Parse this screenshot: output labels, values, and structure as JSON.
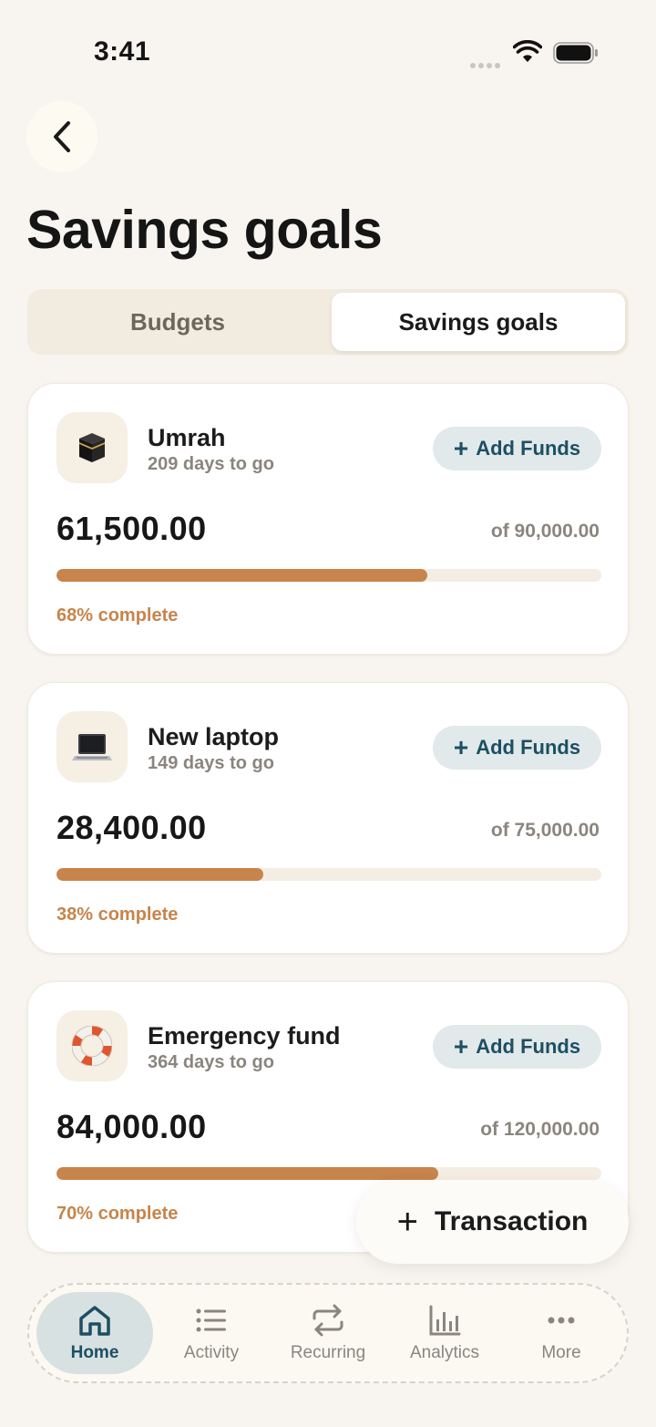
{
  "status_bar": {
    "time": "3:41"
  },
  "header": {
    "title": "Savings goals"
  },
  "segmented": {
    "tabs": [
      {
        "label": "Budgets"
      },
      {
        "label": "Savings goals"
      }
    ],
    "active": "Savings goals"
  },
  "goals": [
    {
      "name": "Umrah",
      "days": "209 days to go",
      "amount": "61,500.00",
      "target": "of 90,000.00",
      "progress": 0.68,
      "complete": "68% complete",
      "icon": "kaaba-icon",
      "button": "Add Funds"
    },
    {
      "name": "New laptop",
      "days": "149 days to go",
      "amount": "28,400.00",
      "target": "of 75,000.00",
      "progress": 0.38,
      "complete": "38% complete",
      "icon": "laptop-icon",
      "button": "Add Funds"
    },
    {
      "name": "Emergency fund",
      "days": "364 days to go",
      "amount": "84,000.00",
      "target": "of 120,000.00",
      "progress": 0.7,
      "complete": "70% complete",
      "icon": "life-ring-icon",
      "button": "Add Funds"
    }
  ],
  "fab": {
    "label": "Transaction"
  },
  "tab_bar": {
    "items": [
      {
        "label": "Home",
        "icon": "home-icon",
        "active": true
      },
      {
        "label": "Activity",
        "icon": "list-icon",
        "active": false
      },
      {
        "label": "Recurring",
        "icon": "repeat-icon",
        "active": false
      },
      {
        "label": "Analytics",
        "icon": "bar-chart-icon",
        "active": false
      },
      {
        "label": "More",
        "icon": "more-icon",
        "active": false
      }
    ]
  },
  "colors": {
    "background": "#f8f4ef",
    "accent": "#c7844b",
    "primary": "#1d4f63",
    "add_funds_bg": "#e1e9ea"
  }
}
